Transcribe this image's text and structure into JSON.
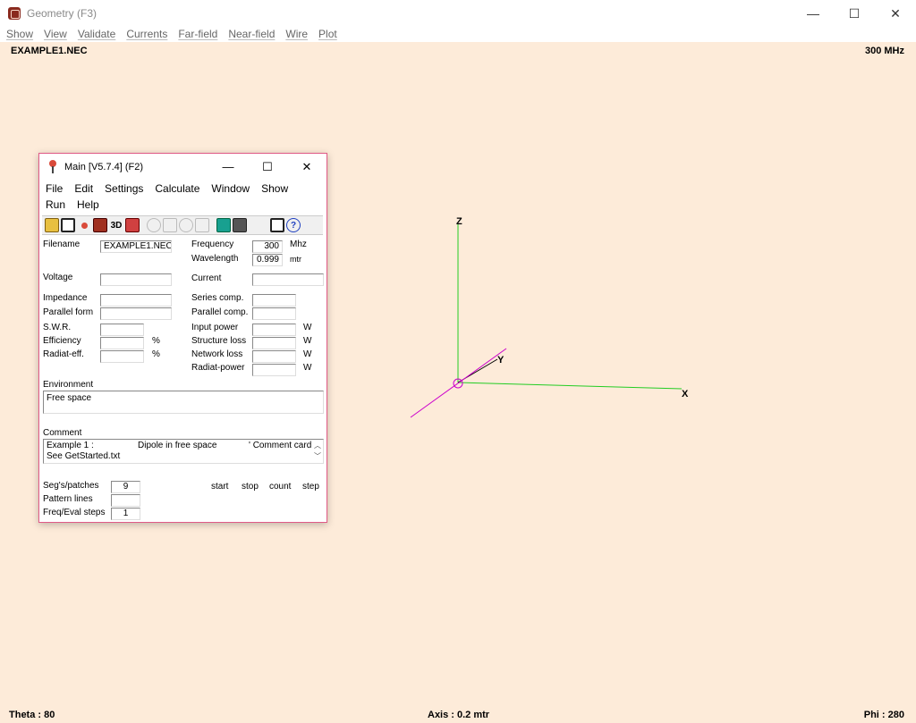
{
  "window": {
    "title": "Geometry   (F3)",
    "controls": {
      "minimize": "—",
      "maximize": "☐",
      "close": "✕"
    }
  },
  "menubar": [
    "Show",
    "View",
    "Validate",
    "Currents",
    "Far-field",
    "Near-field",
    "Wire",
    "Plot"
  ],
  "canvas": {
    "filename": "EXAMPLE1.NEC",
    "frequency": "300 MHz",
    "status": {
      "theta": "Theta : 80",
      "axis": "Axis : 0.2 mtr",
      "phi": "Phi : 280"
    },
    "axes": {
      "x_label": "X",
      "y_label": "Y",
      "z_label": "Z"
    },
    "colors": {
      "x_axis": "#22cc22",
      "y_axis": "#000000",
      "z_axis": "#22cc22",
      "wire": "#cc00cc",
      "background": "#fdebd9"
    }
  },
  "main": {
    "title": "Main [V5.7.4]  (F2)",
    "controls": {
      "minimize": "—",
      "maximize": "☐",
      "close": "✕"
    },
    "menu": [
      "File",
      "Edit",
      "Settings",
      "Calculate",
      "Window",
      "Show",
      "Run",
      "Help"
    ],
    "toolbar": [
      "open-folder-icon",
      "copy-icon",
      "antenna-icon",
      "cube-icon",
      "3d-icon",
      "edit-icon",
      "help-ring-icon",
      "pattern-icon",
      "nearfield-icon",
      "optimize-icon",
      "calculator-icon",
      "grid-icon",
      "zoom-icon",
      "book-icon",
      "help-icon"
    ],
    "toolbar_labels": {
      "three_d": "3D",
      "question": "?"
    },
    "labels": {
      "filename": "Filename",
      "frequency": "Frequency",
      "frequency_unit": "Mhz",
      "wavelength": "Wavelength",
      "wavelength_unit": "mtr",
      "voltage": "Voltage",
      "current": "Current",
      "impedance": "Impedance",
      "series_comp": "Series comp.",
      "parallel_form": "Parallel form",
      "parallel_comp": "Parallel comp.",
      "swr": "S.W.R.",
      "input_power": "Input power",
      "efficiency": "Efficiency",
      "structure_loss": "Structure loss",
      "radiat_eff": "Radiat-eff.",
      "network_loss": "Network loss",
      "radiat_power": "Radiat-power",
      "percent": "%",
      "watt": "W",
      "environment": "Environment",
      "comment": "Comment",
      "segs": "Seg's/patches",
      "pattern_lines": "Pattern lines",
      "freq_steps": "Freq/Eval steps",
      "start": "start",
      "stop": "stop",
      "count": "count",
      "step": "step"
    },
    "values": {
      "filename": "EXAMPLE1.NEC",
      "frequency": "300",
      "wavelength": "0.999",
      "environment": "Free space",
      "comment_line1_a": "Example 1 :",
      "comment_line1_b": "Dipole in free space",
      "comment_line1_c": "' Comment card",
      "comment_line2": "See GetStarted.txt",
      "segs": "9",
      "freq_steps": "1"
    }
  }
}
